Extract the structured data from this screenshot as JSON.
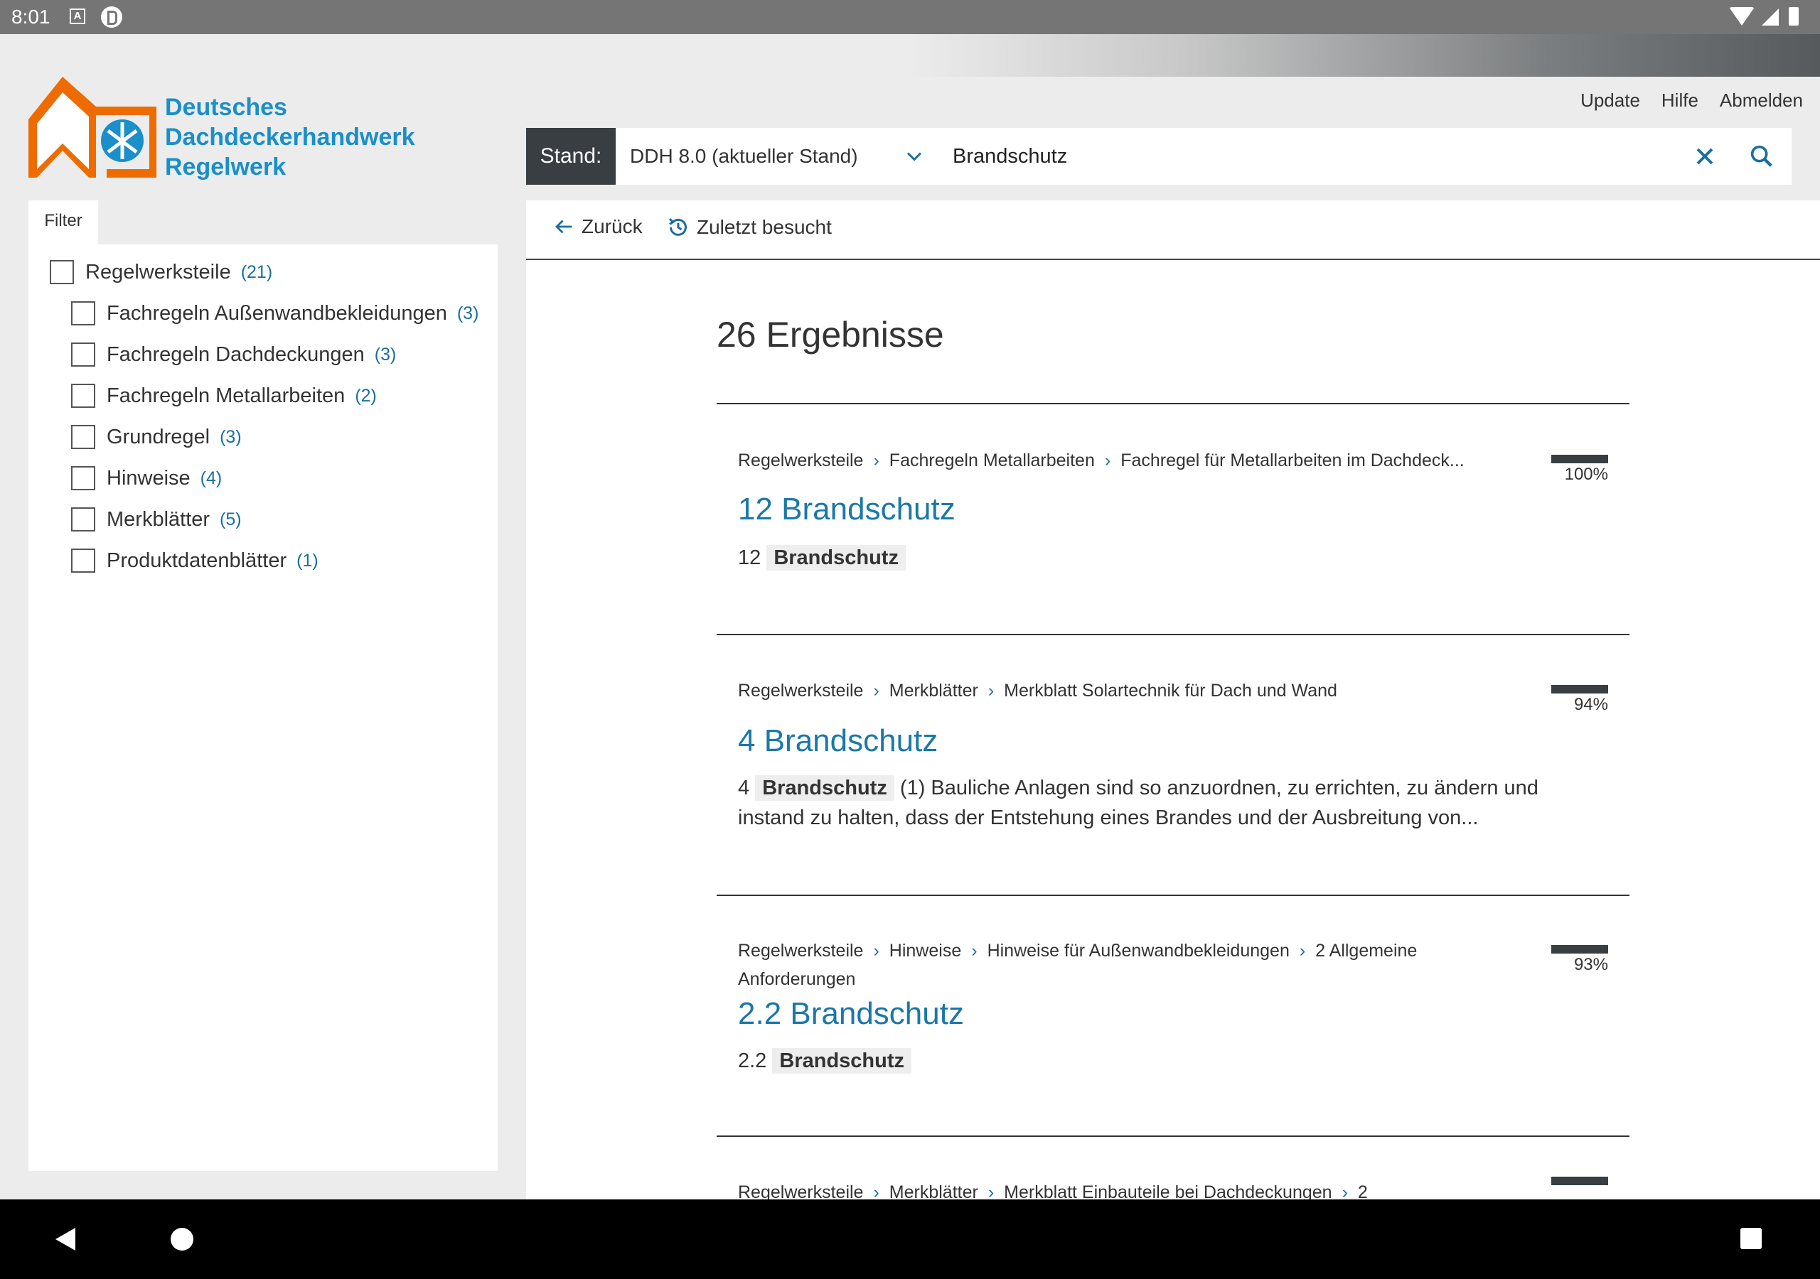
{
  "status_bar": {
    "time": "8:01",
    "icons": [
      "a-notification-icon",
      "p-notification-icon",
      "wifi-icon",
      "cell-signal-icon",
      "battery-icon"
    ]
  },
  "brand": {
    "line1": "Deutsches",
    "line2": "Dachdeckerhandwerk",
    "line3": "Regelwerk",
    "colors": {
      "orange": "#ee6b00",
      "blue": "#1a8fc9"
    }
  },
  "top_links": {
    "update": "Update",
    "help": "Hilfe",
    "logout": "Abmelden"
  },
  "search": {
    "stand_label": "Stand:",
    "stand_value": "DDH 8.0 (aktueller Stand)",
    "query": "Brandschutz"
  },
  "filter": {
    "tab_label": "Filter",
    "root": {
      "label": "Regelwerksteile",
      "count": "(21)"
    },
    "items": [
      {
        "label": "Fachregeln Außenwandbekleidungen",
        "count": "(3)"
      },
      {
        "label": "Fachregeln Dachdeckungen",
        "count": "(3)"
      },
      {
        "label": "Fachregeln Metallarbeiten",
        "count": "(2)"
      },
      {
        "label": "Grundregel",
        "count": "(3)"
      },
      {
        "label": "Hinweise",
        "count": "(4)"
      },
      {
        "label": "Merkblätter",
        "count": "(5)"
      },
      {
        "label": "Produktdatenblätter",
        "count": "(1)"
      }
    ]
  },
  "nav": {
    "back": "Zurück",
    "recent": "Zuletzt besucht"
  },
  "results": {
    "count_label": "26 Ergebnisse",
    "items": [
      {
        "crumbs": [
          "Regelwerksteile",
          "Fachregeln Metallarbeiten",
          "Fachregel für Metallarbeiten im Dachdeck..."
        ],
        "score": "100%",
        "title": "12 Brandschutz",
        "snippet_prefix": "12",
        "snippet_highlight": "Brandschutz",
        "snippet_rest": ""
      },
      {
        "crumbs": [
          "Regelwerksteile",
          "Merkblätter",
          "Merkblatt Solartechnik für Dach und Wand"
        ],
        "score": "94%",
        "title": "4 Brandschutz",
        "snippet_prefix": "4",
        "snippet_highlight": "Brandschutz",
        "snippet_rest": "(1) Bauliche Anlagen sind so anzuordnen, zu errichten, zu ändern und instand zu halten, dass der Entstehung eines Brandes und der Ausbreitung von..."
      },
      {
        "crumbs": [
          "Regelwerksteile",
          "Hinweise",
          "Hinweise für Außenwandbekleidungen",
          "2 Allgemeine Anforderungen"
        ],
        "score": "93%",
        "title": "2.2 Brandschutz",
        "snippet_prefix": "2.2",
        "snippet_highlight": "Brandschutz",
        "snippet_rest": ""
      },
      {
        "crumbs": [
          "Regelwerksteile",
          "Merkblätter",
          "Merkblatt Einbauteile bei Dachdeckungen",
          "2"
        ],
        "score": "",
        "title": "",
        "snippet_prefix": "",
        "snippet_highlight": "",
        "snippet_rest": ""
      }
    ]
  }
}
